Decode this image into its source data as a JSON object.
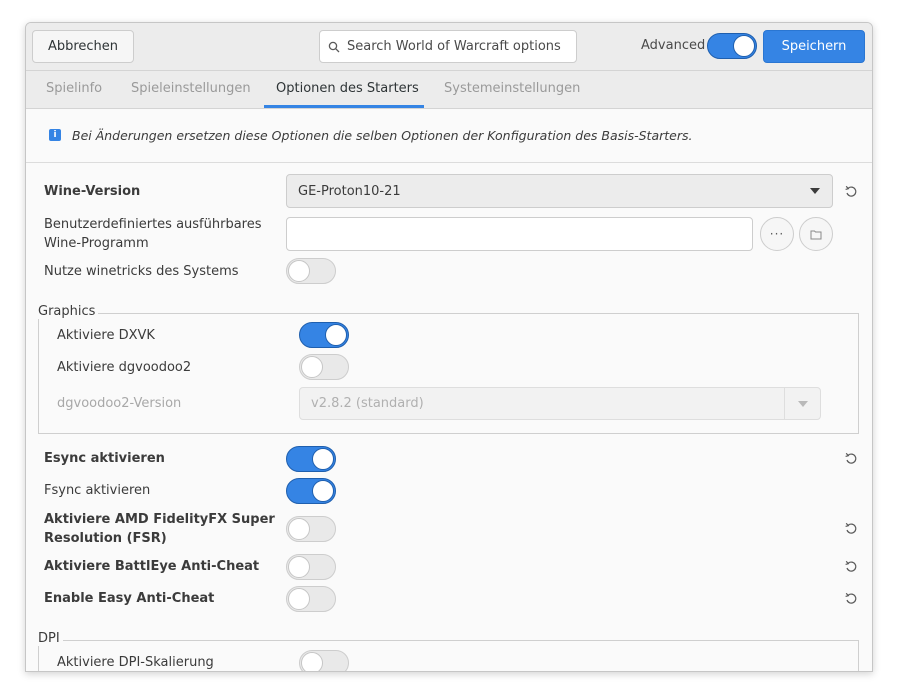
{
  "header": {
    "cancel_label": "Abbrechen",
    "search_placeholder": "Search World of Warcraft options",
    "advanced_label": "Advanced",
    "advanced_on": true,
    "save_label": "Speichern"
  },
  "tabs": [
    {
      "label": "Spielinfo",
      "active": false
    },
    {
      "label": "Spieleinstellungen",
      "active": false
    },
    {
      "label": "Optionen des Starters",
      "active": true
    },
    {
      "label": "Systemeinstellungen",
      "active": false
    }
  ],
  "info": {
    "icon": "info-icon",
    "text": "Bei Änderungen ersetzen diese Optionen die selben Optionen der Konfiguration des Basis-Starters."
  },
  "wine_version": {
    "label": "Wine-Version",
    "value": "GE-Proton10-21"
  },
  "custom_wine": {
    "label_line1": "Benutzerdefiniertes ausführbares",
    "label_line2": "Wine-Programm",
    "value": ""
  },
  "system_winetricks": {
    "label": "Nutze winetricks des Systems",
    "on": false
  },
  "graphics": {
    "title": "Graphics",
    "dxvk": {
      "label": "Aktiviere DXVK",
      "on": true
    },
    "dgvoodoo2": {
      "label": "Aktiviere dgvoodoo2",
      "on": false
    },
    "dgvoodoo2_version": {
      "label": "dgvoodoo2-Version",
      "value": "v2.8.2 (standard)"
    }
  },
  "esync": {
    "label": "Esync aktivieren",
    "on": true
  },
  "fsync": {
    "label": "Fsync aktivieren",
    "on": true
  },
  "fsr": {
    "label_line1": "Aktiviere AMD FidelityFX Super",
    "label_line2": "Resolution (FSR)",
    "on": false
  },
  "battleye": {
    "label": "Aktiviere BattlEye Anti-Cheat",
    "on": false
  },
  "easy_anticheat": {
    "label": "Enable Easy Anti-Cheat",
    "on": false
  },
  "dpi": {
    "title": "DPI",
    "scaling": {
      "label": "Aktiviere DPI-Skalierung",
      "on": false
    }
  },
  "colors": {
    "accent": "#3584e4"
  }
}
